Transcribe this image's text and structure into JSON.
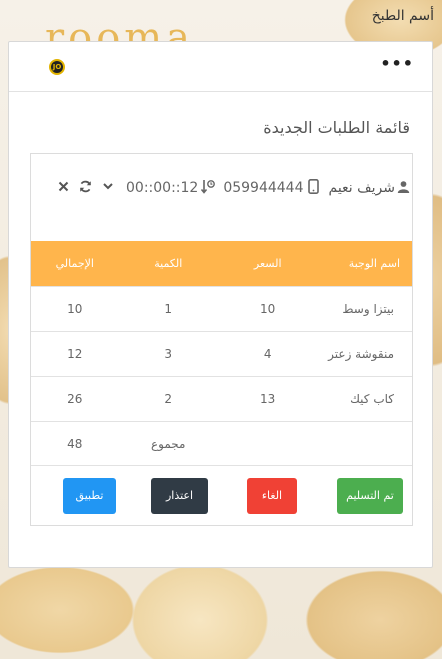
{
  "header": {
    "chef_title": "أسم الطبخ",
    "bg_logo_text": "rooma",
    "app_logo_text": "JO",
    "menu_icon": "more-horizontal-icon"
  },
  "section_title": "قائمة الطلبات الجديدة",
  "order": {
    "customer_name": "شريف نعيم",
    "user_icon": "user-icon",
    "phone": "059944444",
    "phone_icon": "mobile-phone-icon",
    "time": "00::00::12",
    "time_icon": "sort-time-icon",
    "actions": {
      "expand_icon": "chevron-down-icon",
      "refresh_icon": "refresh-icon",
      "close_icon": "close-icon"
    }
  },
  "table": {
    "headers": {
      "meal_name": "اسم الوجبة",
      "price": "السعر",
      "quantity": "الكمية",
      "total": "الإجمالي"
    },
    "rows": [
      {
        "meal_name": "بيتزا وسط",
        "price": "10",
        "quantity": "1",
        "total": "10"
      },
      {
        "meal_name": "منقوشة زعتر",
        "price": "4",
        "quantity": "3",
        "total": "12"
      },
      {
        "meal_name": "كاب كيك",
        "price": "13",
        "quantity": "2",
        "total": "26"
      }
    ],
    "summary": {
      "label": "مجموع",
      "value": "48"
    }
  },
  "buttons": {
    "deliver": "تم التسليم",
    "cancel": "الغاء",
    "apology": "اعتذار",
    "apply": "تطبيق"
  },
  "colors": {
    "table_header": "#ffb54c",
    "deliver": "#4cae4f",
    "cancel": "#f04135",
    "apology": "#303b45",
    "apply": "#2196f3"
  }
}
